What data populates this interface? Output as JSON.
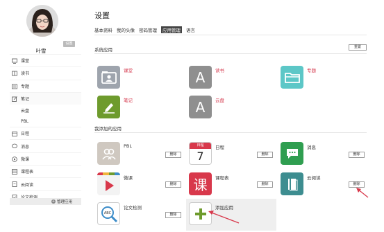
{
  "user": {
    "name": "叶雪",
    "settings_label": "设置"
  },
  "sidebar": {
    "items": [
      {
        "label": "课堂",
        "icon": "classroom-icon"
      },
      {
        "label": "读书",
        "icon": "book-icon"
      },
      {
        "label": "专题",
        "icon": "topic-icon"
      },
      {
        "label": "笔记",
        "icon": "note-icon"
      },
      {
        "label": "云盘",
        "icon": ""
      },
      {
        "label": "PBL",
        "icon": ""
      },
      {
        "label": "日程",
        "icon": "calendar-icon"
      },
      {
        "label": "消息",
        "icon": "message-icon"
      },
      {
        "label": "微课",
        "icon": "microcourse-icon"
      },
      {
        "label": "课程表",
        "icon": "schedule-icon"
      },
      {
        "label": "云阅读",
        "icon": "cloud-read-icon"
      },
      {
        "label": "论文检测",
        "icon": "paper-check-icon"
      }
    ],
    "manage_label": "管理应用"
  },
  "page": {
    "title": "设置"
  },
  "tabs": [
    "基本资料",
    "我的头像",
    "密码管理",
    "应用管理",
    "语言"
  ],
  "active_tab": "应用管理",
  "system_apps": {
    "label": "系统应用",
    "reset_label": "重置",
    "apps": [
      {
        "name": "课堂",
        "icon": "classroom-icon",
        "color": "#9ea4ad"
      },
      {
        "name": "读书",
        "icon": "letter-a-icon",
        "color": "#8f8f8f"
      },
      {
        "name": "专题",
        "icon": "folder-icon",
        "color": "#5cc7c7"
      },
      {
        "name": "笔记",
        "icon": "pencil-icon",
        "color": "#6e9b2d"
      },
      {
        "name": "云盘",
        "icon": "letter-a-icon",
        "color": "#8f8f8f"
      }
    ]
  },
  "my_apps": {
    "label": "我添加的应用",
    "delete_label": "删除",
    "apps": [
      {
        "name": "PBL",
        "icon": "people-icon",
        "color": "#cfc8c0"
      },
      {
        "name": "日程",
        "icon": "calendar-icon",
        "color": "#ffffff",
        "header": "日程",
        "day": "7"
      },
      {
        "name": "消息",
        "icon": "chat-icon",
        "color": "#2f9e50"
      },
      {
        "name": "微课",
        "icon": "play-icon",
        "color": "#f3f3f3"
      },
      {
        "name": "课程表",
        "icon": "schedule-icon",
        "color": "#d8384b",
        "glyph": "课"
      },
      {
        "name": "云阅读",
        "icon": "book-icon",
        "color": "#3d8d90"
      },
      {
        "name": "论文检测",
        "icon": "magnifier-icon",
        "color": "#ffffff",
        "glyph": "ABC"
      }
    ],
    "add_label": "添加应用"
  }
}
